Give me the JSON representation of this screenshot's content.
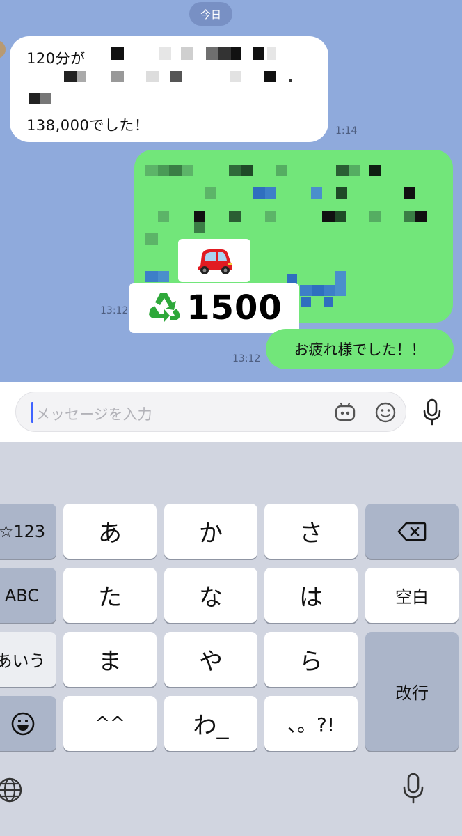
{
  "chat": {
    "date_label": "今日",
    "incoming": {
      "line1_prefix": "120分が",
      "line4": "138,000でした！",
      "time": "1:14"
    },
    "outgoing_big": {
      "time": "13:12"
    },
    "sticker": {
      "number": "1500"
    },
    "outgoing_small": {
      "text": "お疲れ様でした！！",
      "time": "13:12"
    }
  },
  "input": {
    "placeholder": "メッセージを入力"
  },
  "keyboard": {
    "rows": [
      [
        "☆123",
        "あ",
        "か",
        "さ",
        "⌫"
      ],
      [
        "ABC",
        "た",
        "な",
        "は",
        "空白"
      ],
      [
        "あいう",
        "ま",
        "や",
        "ら",
        "改行"
      ],
      [
        "☺",
        "^^",
        "わ_",
        "、。?!"
      ]
    ],
    "left": {
      "numbers": "☆123",
      "abc": "ABC",
      "kana": "あいう"
    },
    "keys": {
      "a": "あ",
      "ka": "か",
      "sa": "さ",
      "ta": "た",
      "na": "な",
      "ha": "は",
      "ma": "ま",
      "ya": "や",
      "ra": "ら",
      "kao": "^^",
      "wa": "わ_",
      "punct": "、。?!"
    },
    "space": "空白",
    "enter": "改行"
  },
  "colors": {
    "chat_bg": "#8faadc",
    "bubble_out": "#72e67a",
    "bubble_in": "#ffffff",
    "keyboard_bg": "#d1d5e0",
    "caret": "#3f63ff"
  }
}
